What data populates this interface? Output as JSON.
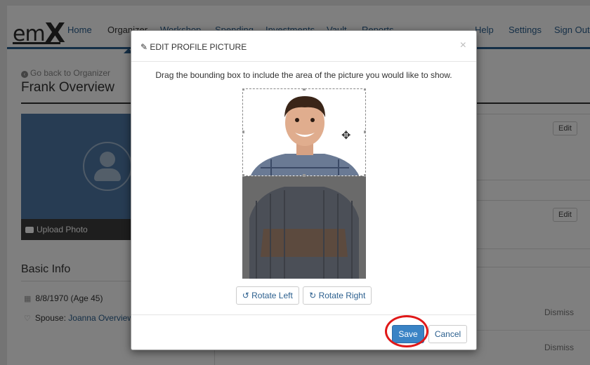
{
  "app": {
    "logo_text": "em",
    "logo_x": "X"
  },
  "nav": {
    "items": [
      "Home",
      "Organizer",
      "Workshop",
      "Spending",
      "Investments",
      "Vault",
      "Reports"
    ],
    "right_items": [
      "Help",
      "Settings",
      "Sign Out"
    ]
  },
  "page": {
    "back_link": "Go back to Organizer",
    "title": "Frank Overview",
    "upload_photo": "Upload Photo",
    "basic_info_heading": "Basic Info",
    "birthdate": "8/8/1970 (Age 45)",
    "spouse_label": "Spouse:",
    "spouse_name": "Joanna Overview",
    "edit_label_1": "Edit",
    "edit_label_2": "Edit",
    "dismiss_1": "Dismiss",
    "dismiss_2": "Dismiss"
  },
  "modal": {
    "title": "EDIT PROFILE PICTURE",
    "close_glyph": "×",
    "instructions": "Drag the bounding box to include the area of the picture you would like to show.",
    "rotate_left": "Rotate Left",
    "rotate_right": "Rotate Right",
    "save": "Save",
    "cancel": "Cancel"
  },
  "colors": {
    "brand": "#2b5f8e",
    "save_button": "#3a83c5",
    "highlight_ring": "#e01818"
  }
}
